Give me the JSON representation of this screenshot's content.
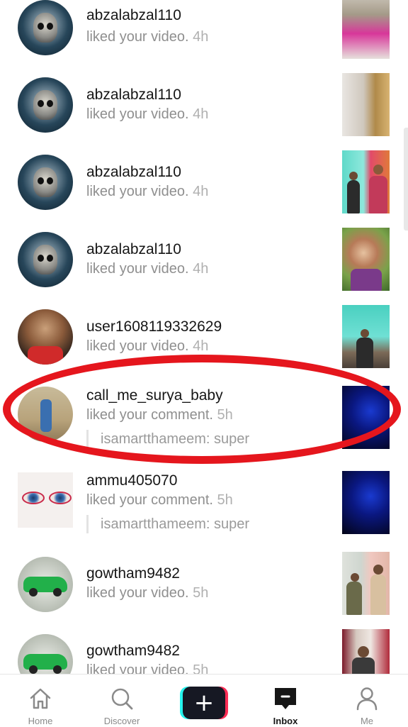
{
  "notifications": [
    {
      "username": "abzalabzal110",
      "action": "liked your video.",
      "time": "4h",
      "avatar": "skull",
      "thumb": "t1"
    },
    {
      "username": "abzalabzal110",
      "action": "liked your video.",
      "time": "4h",
      "avatar": "skull",
      "thumb": "t2"
    },
    {
      "username": "abzalabzal110",
      "action": "liked your video.",
      "time": "4h",
      "avatar": "skull",
      "thumb": "t3"
    },
    {
      "username": "abzalabzal110",
      "action": "liked your video.",
      "time": "4h",
      "avatar": "skull",
      "thumb": "t4"
    },
    {
      "username": "user1608119332629",
      "action": "liked your video.",
      "time": "4h",
      "avatar": "child",
      "thumb": "t5"
    },
    {
      "username": "call_me_surya_baby",
      "action": "liked your comment.",
      "time": "5h",
      "comment": "isamartthameem: super",
      "avatar": "boy",
      "thumb": "t6"
    },
    {
      "username": "ammu405070",
      "action": "liked your comment.",
      "time": "5h",
      "comment": "isamartthameem: super",
      "avatar": "eyes",
      "thumb": "t6"
    },
    {
      "username": "gowtham9482",
      "action": "liked your video.",
      "time": "5h",
      "avatar": "car",
      "thumb": "t7"
    },
    {
      "username": "gowtham9482",
      "action": "liked your video.",
      "time": "5h",
      "avatar": "car",
      "thumb": "t8"
    }
  ],
  "tabbar": {
    "home": {
      "label": "Home",
      "icon": "home-icon"
    },
    "discover": {
      "label": "Discover",
      "icon": "search-icon"
    },
    "create": {
      "label": "+",
      "icon": "plus-icon"
    },
    "inbox": {
      "label": "Inbox",
      "icon": "inbox-icon",
      "active": true
    },
    "me": {
      "label": "Me",
      "icon": "profile-icon"
    }
  },
  "colors": {
    "annotation": "#e5161d",
    "accent_cyan": "#25f4ee",
    "accent_pink": "#fe2c55"
  }
}
